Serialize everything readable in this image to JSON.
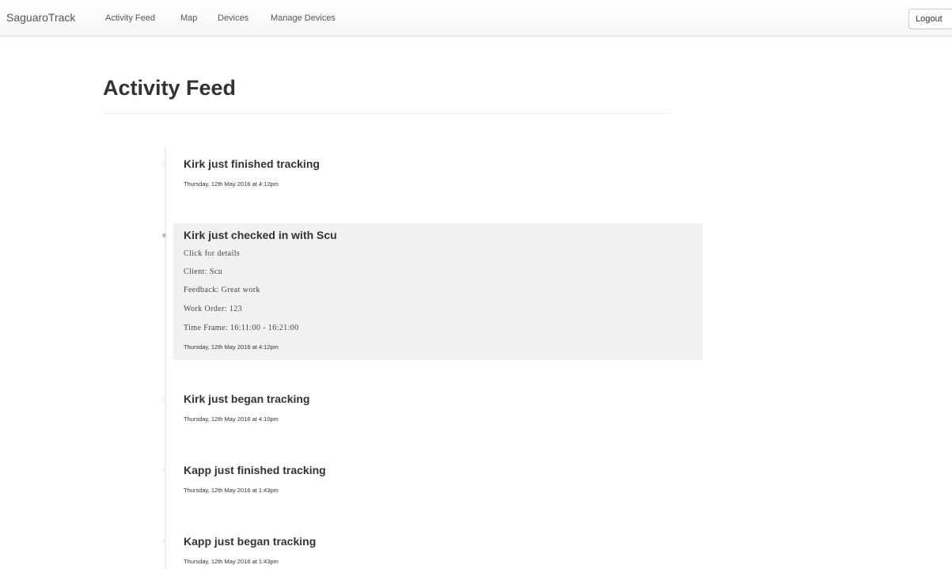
{
  "nav": {
    "brand": "SaguaroTrack",
    "links": [
      "Activity Feed",
      "Map",
      "Devices",
      "Manage Devices"
    ],
    "logout": "Logout"
  },
  "page": {
    "title": "Activity Feed"
  },
  "feed": [
    {
      "title": "Kirk just finished tracking",
      "date": "Thursday, 12th May 2016 at 4:12pm"
    },
    {
      "title": "Kirk just checked in with Scu",
      "details": [
        "Click for details",
        "Client: Scu",
        "Feedback: Great work",
        "Work Order: 123",
        "Time Frame: 16:11:00 - 16:21:00"
      ],
      "date": "Thursday, 12th May 2016 at 4:12pm"
    },
    {
      "title": "Kirk just began tracking",
      "date": "Thursday, 12th May 2016 at 4:10pm"
    },
    {
      "title": "Kapp just finished tracking",
      "date": "Thursday, 12th May 2016 at 1:43pm"
    },
    {
      "title": "Kapp just began tracking",
      "date": "Thursday, 12th May 2016 at 1:43pm"
    }
  ]
}
